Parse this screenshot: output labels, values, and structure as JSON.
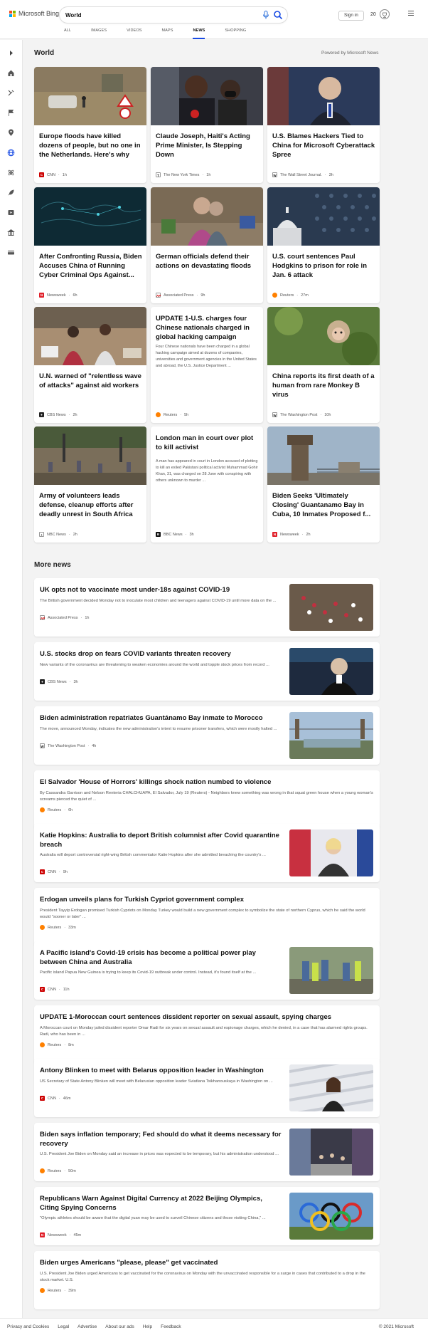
{
  "header": {
    "logo_text": "Microsoft Bing",
    "search_value": "World",
    "signin_label": "Sign in",
    "points": "20",
    "tabs": [
      {
        "label": "ALL"
      },
      {
        "label": "IMAGES"
      },
      {
        "label": "VIDEOS"
      },
      {
        "label": "MAPS"
      },
      {
        "label": "NEWS"
      },
      {
        "label": "SHOPPING"
      }
    ],
    "active_tab": "NEWS"
  },
  "sidebar": {
    "icons": [
      "chevron-right-icon",
      "home-icon",
      "tools-icon",
      "flag-icon",
      "location-icon",
      "globe-icon",
      "science-icon",
      "rocket-icon",
      "entertainment-icon",
      "business-icon",
      "money-icon"
    ]
  },
  "world": {
    "title": "World",
    "powered_by": "Powered by Microsoft News",
    "cards": [
      {
        "title": "Europe floods have killed dozens of people, but no one in the Netherlands. Here's why",
        "source": "CNN",
        "time": "1h"
      },
      {
        "title": "Claude Joseph, Haiti's Acting Prime Minister, Is Stepping Down",
        "source": "The New York Times",
        "time": "1h"
      },
      {
        "title": "U.S. Blames Hackers Tied to China for Microsoft Cyberattack Spree",
        "source": "The Wall Street Journal.",
        "time": "3h"
      },
      {
        "title": "After Confronting Russia, Biden Accuses China of Running Cyber Criminal Ops Against...",
        "source": "Newsweek",
        "time": "6h"
      },
      {
        "title": "German officials defend their actions on devastating floods",
        "source": "Associated Press",
        "time": "9h"
      },
      {
        "title": "U.S. court sentences Paul Hodgkins to prison for role in Jan. 6 attack",
        "source": "Reuters",
        "time": "27m"
      },
      {
        "title": "U.N. warned of \"relentless wave of attacks\" against aid workers",
        "source": "CBS News",
        "time": "2h"
      },
      {
        "title": "UPDATE 1-U.S. charges four Chinese nationals charged in global hacking campaign",
        "snippet": "Four Chinese nationals have been charged in a global hacking campaign aimed at dozens of companies, universities and government agencies in the United States and abroad, the U.S. Justice Department ...",
        "source": "Reuters",
        "time": "5h"
      },
      {
        "title": "China reports its first death of a human from rare Monkey B virus",
        "source": "The Washington Post",
        "time": "10h"
      },
      {
        "title": "Army of volunteers leads defense, cleanup efforts after deadly unrest in South Africa",
        "source": "NBC News",
        "time": "2h"
      },
      {
        "title": "London man in court over plot to kill activist",
        "snippet": "A man has appeared in court in London accused of plotting to kill an exiled Pakistani political activist Muhammad Gohir Khan, 31, was charged on 28 June with conspiring with others unknown to murder ...",
        "source": "BBC News",
        "time": "3h"
      },
      {
        "title": "Biden Seeks 'Ultimately Closing' Guantanamo Bay in Cuba, 10 Inmates Proposed f...",
        "source": "Newsweek",
        "time": "2h"
      }
    ]
  },
  "more_news": {
    "title": "More news",
    "items": [
      {
        "title": "UK opts not to vaccinate most under-18s against COVID-19",
        "snippet": "The British government decided Monday not to inoculate most children and teenagers against COVID-19 until more data on the ...",
        "source": "Associated Press",
        "time": "1h"
      },
      {
        "title": "U.S. stocks drop on fears COVID variants threaten recovery",
        "snippet": "New variants of the coronavirus are threatening to weaken economies around the world and topple stock prices from record ...",
        "source": "CBS News",
        "time": "3h"
      },
      {
        "title": "Biden administration repatriates Guantánamo Bay inmate to Morocco",
        "snippet": "The move, announced Monday, indicates the new administration's intent to resume prisoner transfers, which were mostly halted ...",
        "source": "The Washington Post",
        "time": "4h"
      },
      {
        "title": "El Salvador 'House of Horrors' killings shock nation numbed to violence",
        "snippet": "By Cassandra Garrison and Nelson Renteria CHALCHUAPA, El Salvador, July 19 (Reuters) - Neighbors knew something was wrong in that squat green house when a young woman's screams pierced the quiet of ...",
        "source": "Reuters",
        "time": "6h"
      },
      {
        "title": "Katie Hopkins: Australia to deport British columnist after Covid quarantine breach",
        "snippet": "Australia will deport controversial right-wing British commentator Katie Hopkins after she admitted breaching the country's ...",
        "source": "CNN",
        "time": "9h"
      },
      {
        "title": "Erdogan unveils plans for Turkish Cypriot government complex",
        "snippet": "President Tayyip Erdogan promised Turkish Cypriots on Monday Turkey would build a new government complex to symbolize the state of northern Cyprus, which he said the world would \"sooner or later\" ...",
        "source": "Reuters",
        "time": "33m"
      },
      {
        "title": "A Pacific island's Covid-19 crisis has become a political power play between China and Australia",
        "snippet": "Pacific island Papua New Guinea is trying to keep its Covid-19 outbreak under control. Instead, it's found itself at the ...",
        "source": "CNN",
        "time": "11h"
      },
      {
        "title": "UPDATE 1-Moroccan court sentences dissident reporter on sexual assault, spying charges",
        "snippet": "A Moroccan court on Monday jailed dissident reporter Omar Radi for six years on sexual assault and espionage charges, which he denied, in a case that has alarmed rights groups. Radi, who has been in ...",
        "source": "Reuters",
        "time": "8m"
      },
      {
        "title": "Antony Blinken to meet with Belarus opposition leader in Washington",
        "snippet": "US Secretary of State Antony Blinken will meet with Belarusian opposition leader Sviatlana Tsikhanouskaya in Washington on ...",
        "source": "CNN",
        "time": "46m"
      },
      {
        "title": "Biden says inflation temporary; Fed should do what it deems necessary for recovery",
        "snippet": "U.S. President Joe Biden on Monday said an increase in prices was expected to be temporary, but his administration understood ...",
        "source": "Reuters",
        "time": "50m"
      },
      {
        "title": "Republicans Warn Against Digital Currency at 2022 Beijing Olympics, Citing Spying Concerns",
        "snippet": "\"Olympic athletes should be aware that the digital yuan may be used to surveil Chinese citizens and those visiting China,\" ...",
        "source": "Newsweek",
        "time": "45m"
      },
      {
        "title": "Biden urges Americans \"please, please\" get vaccinated",
        "snippet": "U.S. President Joe Biden urged Americans to get vaccinated for the coronavirus on Monday with the unvaccinated responsible for a surge in cases that contributed to a drop in the stock market. U.S.",
        "source": "Reuters",
        "time": "39m"
      }
    ]
  },
  "footer": {
    "links": [
      "Privacy and Cookies",
      "Legal",
      "Advertise",
      "About our ads",
      "Help",
      "Feedback"
    ],
    "copyright": "© 2021 Microsoft"
  },
  "colors": {
    "accent": "#174ae4",
    "cnn": "#cc0000",
    "reuters": "#ff8000",
    "newsweek": "#e0202a"
  }
}
